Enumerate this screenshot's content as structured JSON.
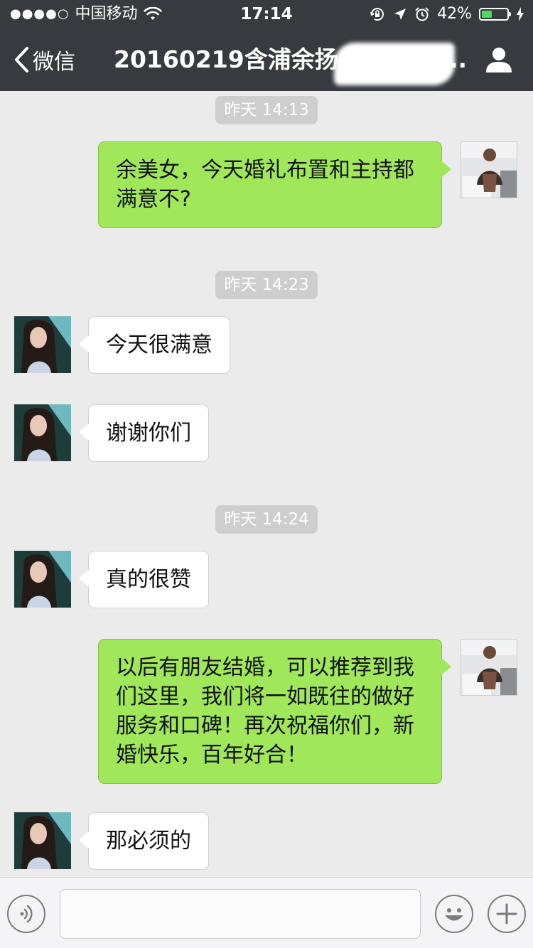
{
  "status_bar": {
    "signal_dots": "●●●●○",
    "carrier": "中国移动",
    "time": "17:14",
    "battery_percent_text": "42%",
    "battery_level": 0.42,
    "battery_color": "#4cd964"
  },
  "nav": {
    "back_label": "微信",
    "title": "20160219含浦余扬",
    "title_ellipsis": "..",
    "profile_icon": "person-icon"
  },
  "messages": [
    {
      "type": "time",
      "text": "昨天 14:13"
    },
    {
      "type": "msg",
      "from": "me",
      "text": "余美女，今天婚礼布置和主持都满意不?"
    },
    {
      "type": "time",
      "text": "昨天 14:23"
    },
    {
      "type": "msg",
      "from": "her",
      "text": "今天很满意"
    },
    {
      "type": "msg",
      "from": "her",
      "text": "谢谢你们"
    },
    {
      "type": "time",
      "text": "昨天 14:24"
    },
    {
      "type": "msg",
      "from": "her",
      "text": "真的很赞"
    },
    {
      "type": "msg",
      "from": "me",
      "text": "以后有朋友结婚，可以推荐到我们这里，我们将一如既往的做好服务和口碑！再次祝福你们，新婚快乐，百年好合！"
    },
    {
      "type": "msg",
      "from": "her",
      "text": "那必须的"
    }
  ],
  "colors": {
    "nav_background": "#373a3e",
    "chat_background": "#ebebeb",
    "my_bubble": "#a0e75a",
    "her_bubble": "#ffffff"
  },
  "input_bar": {
    "voice_icon": "voice-icon",
    "emoji_icon": "emoji-icon",
    "plus_icon": "plus-icon"
  }
}
